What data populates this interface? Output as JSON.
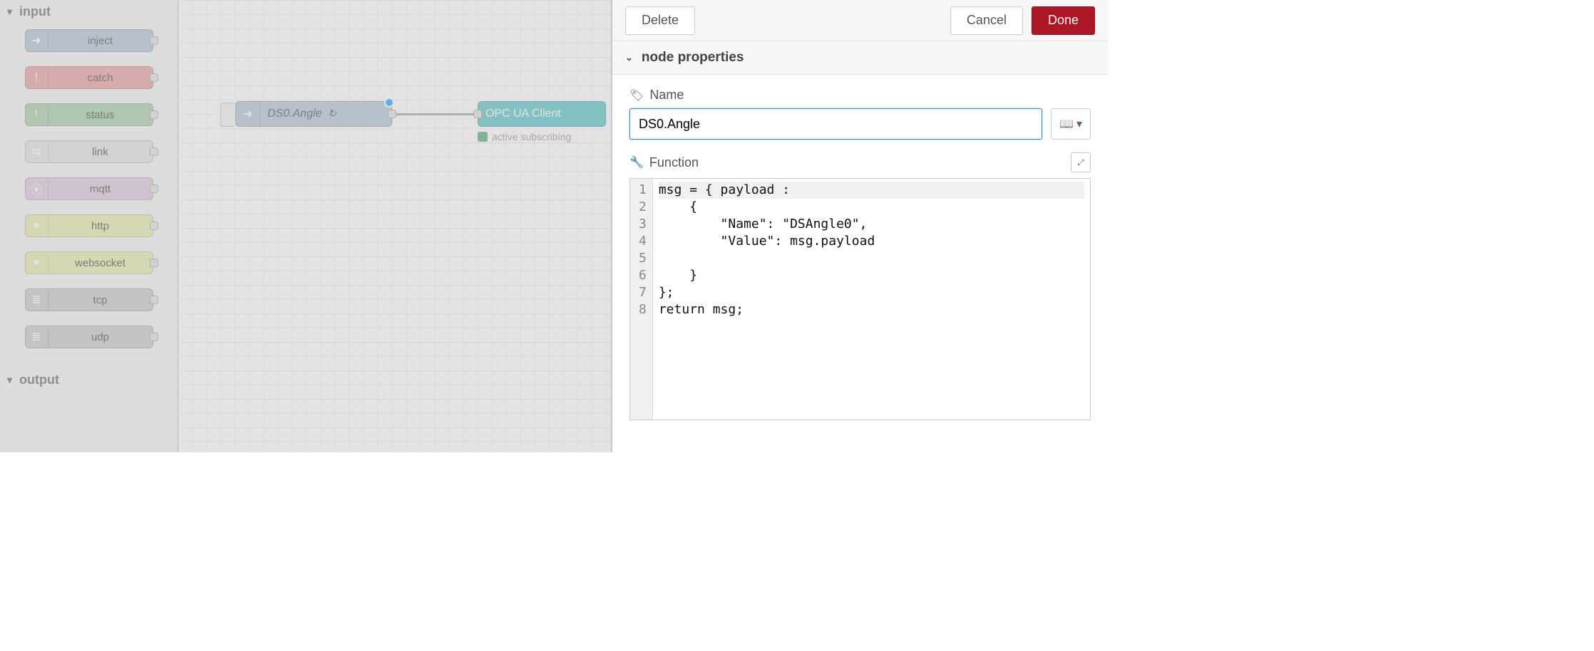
{
  "palette": {
    "categories": [
      {
        "id": "input",
        "label": "input",
        "expanded": true
      },
      {
        "id": "output",
        "label": "output",
        "expanded": true
      }
    ],
    "input_nodes": [
      {
        "name": "inject",
        "class": "n-inject",
        "icon": "arrow-right"
      },
      {
        "name": "catch",
        "class": "n-catch",
        "icon": "alert"
      },
      {
        "name": "status",
        "class": "n-status",
        "icon": "alert"
      },
      {
        "name": "link",
        "class": "n-link",
        "icon": "link"
      },
      {
        "name": "mqtt",
        "class": "n-mqtt",
        "icon": "radio"
      },
      {
        "name": "http",
        "class": "n-http",
        "icon": "globe"
      },
      {
        "name": "websocket",
        "class": "n-ws",
        "icon": "globe"
      },
      {
        "name": "tcp",
        "class": "n-tcp",
        "icon": "bars"
      },
      {
        "name": "udp",
        "class": "n-udp",
        "icon": "bars"
      }
    ]
  },
  "canvas": {
    "nodes": {
      "inject": {
        "label": "DS0.Angle"
      },
      "opcua": {
        "label": "OPC UA Client"
      }
    },
    "status": {
      "text": "active subscribing"
    }
  },
  "editor": {
    "toolbar": {
      "delete": "Delete",
      "cancel": "Cancel",
      "done": "Done"
    },
    "section_title": "node properties",
    "form": {
      "name_label": "Name",
      "name_value": "DS0.Angle",
      "function_label": "Function",
      "code_lines": [
        "msg = { payload :",
        "    {",
        "        \"Name\": \"DSAngle0\",",
        "        \"Value\": msg.payload",
        "",
        "    }",
        "};",
        "return msg;"
      ]
    }
  },
  "glyphs": {
    "chevron_down": "▾",
    "chevron_down_small": "⌄",
    "arrow_right": "➔",
    "alert": "!",
    "link": "⇆",
    "radio": "⦿",
    "globe": "●",
    "bars": "≣",
    "tag": "🏷",
    "wrench": "🔧",
    "book": "📖",
    "expand": "⤢",
    "refresh": "↻"
  }
}
